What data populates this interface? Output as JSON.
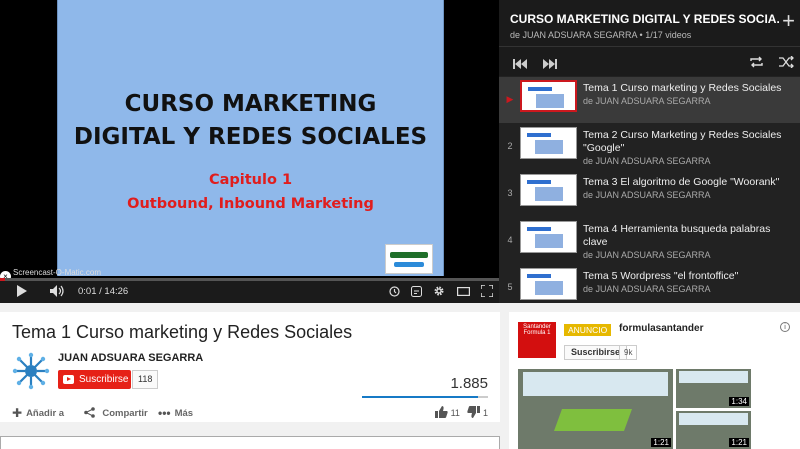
{
  "video": {
    "slide_title_line1": "CURSO MARKETING",
    "slide_title_line2": "DIGITAL Y REDES SOCIALES",
    "slide_sub_line1": "Capitulo 1",
    "slide_sub_line2": "Outbound, Inbound Marketing",
    "slide_logo": "igeasoftware",
    "watermark": "Screencast-O-Matic.com",
    "watermark_close": "×",
    "current_time": "0:01",
    "duration": "14:26",
    "progress_fraction": 0.01
  },
  "controls": {
    "play": "play-icon",
    "volume": "volume-icon",
    "annotations": "info-icon",
    "watch_later": "clock-icon",
    "settings": "gear-icon",
    "theater": "theater-icon",
    "fullscreen": "fullscreen-icon"
  },
  "playlist": {
    "title": "CURSO MARKETING DIGITAL Y REDES SOCIA...",
    "meta": "de JUAN ADSUARA SEGARRA • 1/17 videos",
    "add": "+",
    "items": [
      {
        "index": "▶",
        "title": "Tema 1 Curso marketing y Redes Sociales",
        "author": "de JUAN ADSUARA SEGARRA",
        "active": true
      },
      {
        "index": "2",
        "title": "Tema 2 Curso Marketing y Redes Sociales \"Google\"",
        "author": "de JUAN ADSUARA SEGARRA",
        "active": false
      },
      {
        "index": "3",
        "title": "Tema 3 El algoritmo de Google \"Woorank\"",
        "author": "de JUAN ADSUARA SEGARRA",
        "active": false
      },
      {
        "index": "4",
        "title": "Tema 4 Herramienta busqueda palabras clave",
        "author": "de JUAN ADSUARA SEGARRA",
        "active": false
      },
      {
        "index": "5",
        "title": "Tema 5 Wordpress \"el frontoffice\"",
        "author": "de JUAN ADSUARA SEGARRA",
        "active": false
      }
    ]
  },
  "info": {
    "title": "Tema 1 Curso marketing y Redes Sociales",
    "channel": "JUAN ADSUARA SEGARRA",
    "subscribe_label": "Suscribirse",
    "subscriber_count": "118",
    "views": "1.885",
    "likes_fraction": 0.92,
    "add_label": "Añadir a",
    "share_label": "Compartir",
    "more_label": "Más",
    "likes": "11",
    "dislikes": "1"
  },
  "ad": {
    "logo_text": "Santander Formula 1",
    "badge": "ANUNCIO",
    "name": "formulasantander",
    "info": "i",
    "subscribe_label": "Suscribirse",
    "subscriber_count": "9k",
    "thumb1_duration": "1:21",
    "thumb2_duration": "1:34",
    "thumb3_duration": "1:21"
  },
  "colors": {
    "accent_red": "#cc181e",
    "like_blue": "#167ac6",
    "slide_bg": "#8fb8ea",
    "ad_badge": "#e6b800"
  }
}
